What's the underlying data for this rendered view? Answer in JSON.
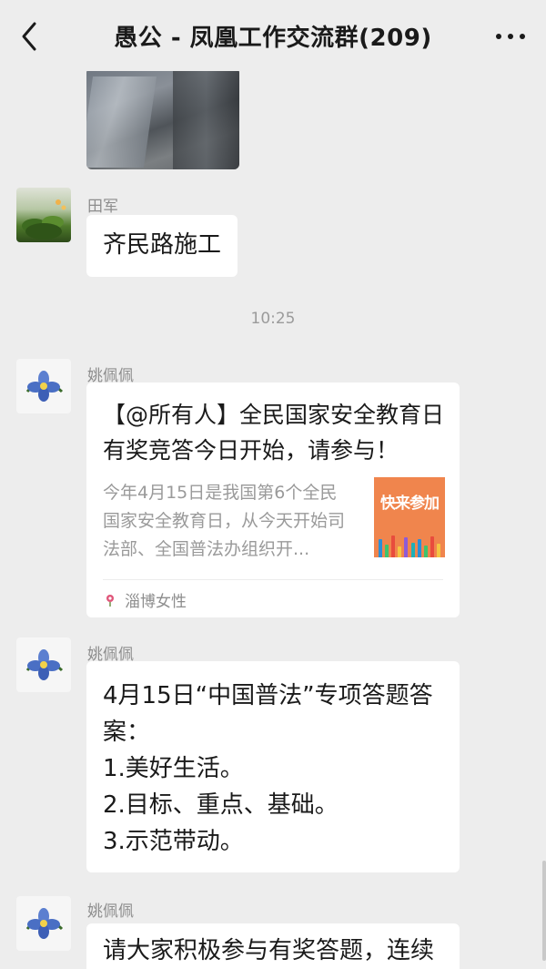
{
  "header": {
    "title": "愚公 - 凤凰工作交流群(209)"
  },
  "messages": {
    "tianjun": {
      "sender": "田军",
      "text": "齐民路施工"
    },
    "timestamp": "10:25",
    "card": {
      "sender": "姚佩佩",
      "title": "【@所有人】全民国家安全教育日有奖竞答今日开始，请参与！",
      "description": "今年4月15日是我国第6个全民国家安全教育日，从今天开始司法部、全国普法办组织开...",
      "thumbnail_text": "快来参加",
      "source": "淄博女性"
    },
    "answer": {
      "sender": "姚佩佩",
      "lines": [
        "4月15日“中国普法”专项答题答案：",
        "1.美好生活。",
        "2.目标、重点、基础。",
        "3.示范带动。"
      ]
    },
    "partial": {
      "sender": "姚佩佩",
      "text": "请大家积极参与有奖答题，连续三"
    }
  },
  "colors": {
    "background": "#ededed",
    "bubble": "#ffffff",
    "card_thumb": "#f0854d"
  },
  "icons": {
    "back": "chevron-left-icon",
    "more": "more-dots-icon",
    "source": "flower-logo-icon"
  }
}
